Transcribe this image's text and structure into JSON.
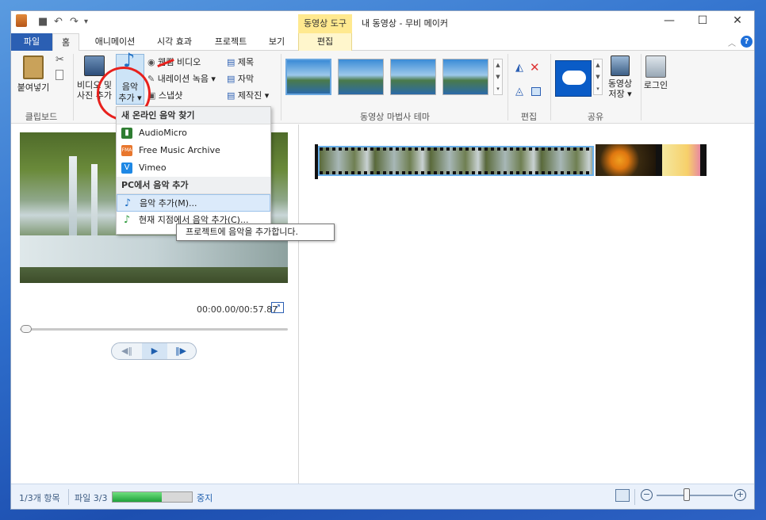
{
  "titlebar": {
    "title": "내 동영상 - 무비 메이커",
    "tool_tab": "동영상 도구",
    "minimize": "—",
    "maximize": "☐",
    "close": "✕",
    "qat_sep": "▾"
  },
  "tabs": {
    "file": "파일",
    "home": "홈",
    "animation": "애니메이션",
    "visual_effects": "시각 효과",
    "project": "프로젝트",
    "view": "보기",
    "edit": "편집"
  },
  "ribbon": {
    "paste": "붙여넣기",
    "clipboard_group": "클립보드",
    "add_video_line1": "비디오 및",
    "add_video_line2": "사진 추가",
    "add_music_line1": "음악",
    "add_music_line2": "추가 ▾",
    "webcam": "웹캠 비디오",
    "narration": "내레이션 녹음 ▾",
    "snapshot": "스냅샷",
    "title": "제목",
    "caption": "자막",
    "credits": "제작진 ▾",
    "theme_group": "동영상 마법사 테마",
    "edit_group": "편집",
    "share_group": "공유",
    "save_movie_line1": "동영상",
    "save_movie_line2": "저장 ▾",
    "login": "로그인"
  },
  "dropdown": {
    "online_header": "새 온라인 음악 찾기",
    "items_online": [
      {
        "label": "AudioMicro",
        "icon": "audio-bars-icon",
        "color": "#2e7d32"
      },
      {
        "label": "Free Music Archive",
        "icon": "fma-icon",
        "color": "#e8772e"
      },
      {
        "label": "Vimeo",
        "icon": "vimeo-icon",
        "color": "#1e88e5"
      }
    ],
    "pc_header": "PC에서 음악 추가",
    "add_music": "음악 추가(M)...",
    "add_at_point": "현재 지점에서 음악 추가(C)..."
  },
  "tooltip": "프로젝트에 음악을 추가합니다.",
  "player": {
    "time": "00:00.00/00:57.87"
  },
  "status": {
    "items": "1/3개 항목",
    "file_progress": "파일 3/3",
    "progress": 0.62,
    "stop": "중지"
  },
  "colors": {
    "accent": "#2b5fb3",
    "annotation": "#e8211d",
    "progress": "#29b34a"
  }
}
